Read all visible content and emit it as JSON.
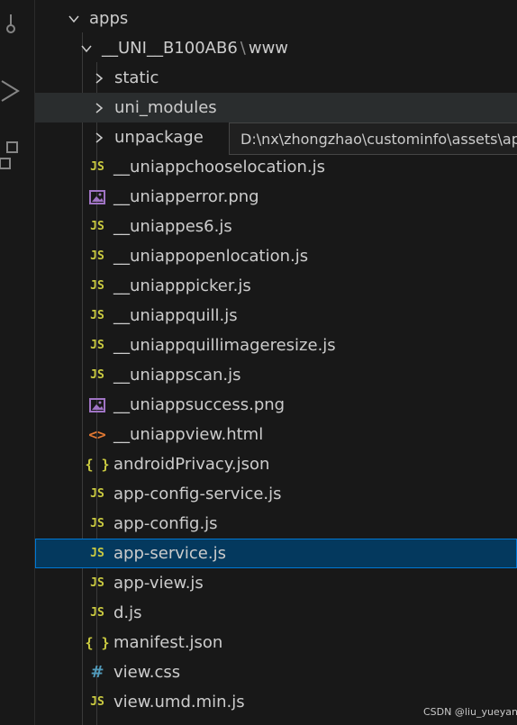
{
  "explorer": {
    "root_folder": "apps",
    "sub_folder": {
      "name": "__UNI__B100AB6",
      "separator": "\\",
      "child": "www"
    },
    "folders": [
      "static",
      "uni_modules",
      "unpackage"
    ],
    "files": [
      {
        "name": "__uniappchooselocation.js",
        "icon": "js-icon",
        "icon_text": "JS"
      },
      {
        "name": "__uniapperror.png",
        "icon": "image-icon",
        "icon_text": ""
      },
      {
        "name": "__uniappes6.js",
        "icon": "js-icon",
        "icon_text": "JS"
      },
      {
        "name": "__uniappopenlocation.js",
        "icon": "js-icon",
        "icon_text": "JS"
      },
      {
        "name": "__uniapppicker.js",
        "icon": "js-icon",
        "icon_text": "JS"
      },
      {
        "name": "__uniappquill.js",
        "icon": "js-icon",
        "icon_text": "JS"
      },
      {
        "name": "__uniappquillimageresize.js",
        "icon": "js-icon",
        "icon_text": "JS"
      },
      {
        "name": "__uniappscan.js",
        "icon": "js-icon",
        "icon_text": "JS"
      },
      {
        "name": "__uniappsuccess.png",
        "icon": "image-icon",
        "icon_text": ""
      },
      {
        "name": "__uniappview.html",
        "icon": "html-icon",
        "icon_text": "<>"
      },
      {
        "name": "androidPrivacy.json",
        "icon": "json-icon",
        "icon_text": "{ }"
      },
      {
        "name": "app-config-service.js",
        "icon": "js-icon",
        "icon_text": "JS"
      },
      {
        "name": "app-config.js",
        "icon": "js-icon",
        "icon_text": "JS"
      },
      {
        "name": "app-service.js",
        "icon": "js-icon",
        "icon_text": "JS"
      },
      {
        "name": "app-view.js",
        "icon": "js-icon",
        "icon_text": "JS"
      },
      {
        "name": "d.js",
        "icon": "js-icon",
        "icon_text": "JS"
      },
      {
        "name": "manifest.json",
        "icon": "json-icon",
        "icon_text": "{ }"
      },
      {
        "name": "view.css",
        "icon": "css-icon",
        "icon_text": "#"
      },
      {
        "name": "view.umd.min.js",
        "icon": "js-icon",
        "icon_text": "JS"
      }
    ],
    "hovered_item": "uni_modules",
    "selected_item": "app-service.js"
  },
  "tooltip": {
    "text": "D:\\nx\\zhongzhao\\custominfo\\assets\\ap"
  },
  "watermark": "CSDN @liu_yueyang",
  "colors": {
    "background": "#181818",
    "selection": "#04395e",
    "focus_border": "#0078d4",
    "js_icon": "#cbcb41",
    "css_icon": "#519aba",
    "html_icon": "#e37933",
    "image_icon": "#a074c4"
  }
}
